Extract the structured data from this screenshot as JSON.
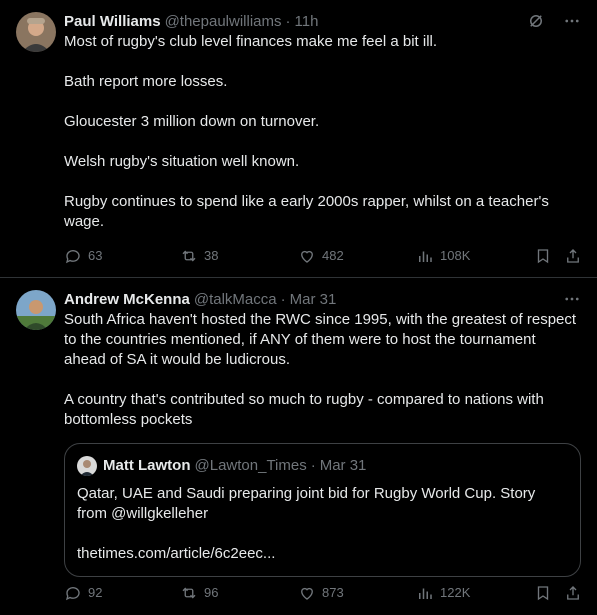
{
  "tweets": [
    {
      "name": "Paul Williams",
      "handle": "@thepaulwilliams",
      "time": "11h",
      "paragraphs": [
        "Most of rugby's club level finances make me feel a bit ill.",
        "Bath report more losses.",
        "Gloucester 3 million down on turnover.",
        "Welsh rugby's situation well known.",
        "Rugby continues to spend like a early 2000s rapper, whilst on a teacher's wage."
      ],
      "replies": "63",
      "reposts": "38",
      "likes": "482",
      "views": "108K",
      "icons": [
        "avatar",
        "grok-icon",
        "more-icon",
        "reply-icon",
        "repost-icon",
        "like-icon",
        "views-icon",
        "bookmark-icon",
        "share-icon"
      ]
    },
    {
      "name": "Andrew McKenna",
      "handle": "@talkMacca",
      "time": "Mar 31",
      "paragraphs": [
        "South Africa haven't hosted the RWC since 1995, with the greatest of respect to the countries mentioned, if ANY of them were to host the tournament ahead of SA it would be ludicrous.",
        "A country that's contributed so much to rugby - compared to nations with bottomless pockets"
      ],
      "quote": {
        "name": "Matt Lawton",
        "handle": "@Lawton_Times",
        "time": "Mar 31",
        "text": "Qatar, UAE and Saudi preparing joint bid for Rugby World Cup. Story from @willgkelleher",
        "link": "thetimes.com/article/6c2eec..."
      },
      "replies": "92",
      "reposts": "96",
      "likes": "873",
      "views": "122K"
    }
  ],
  "colors": {
    "background": "#000000",
    "text": "#e7e9ea",
    "secondary": "#71767b",
    "border": "#2f3336"
  }
}
